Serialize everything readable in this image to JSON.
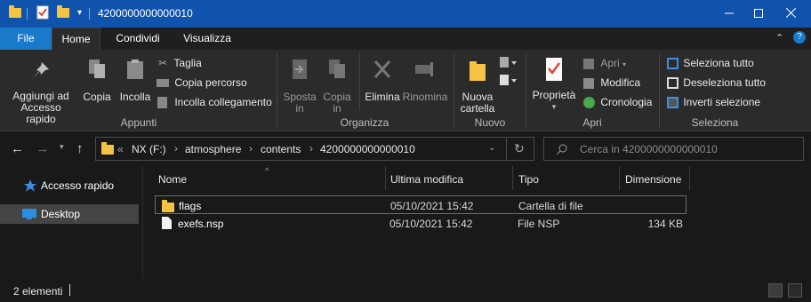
{
  "window": {
    "title": "4200000000000010",
    "minimize_icon": "minimize-icon",
    "maximize_icon": "maximize-icon",
    "close_icon": "close-icon"
  },
  "ribbon_tabs": {
    "file": "File",
    "home": "Home",
    "share": "Condividi",
    "view": "Visualizza"
  },
  "ribbon": {
    "pin": "Aggiungi ad\nAccesso rapido",
    "pin_l1": "Aggiungi ad",
    "pin_l2": "Accesso rapido",
    "copy": "Copia",
    "paste": "Incolla",
    "cut": "Taglia",
    "copy_path": "Copia percorso",
    "paste_shortcut": "Incolla collegamento",
    "group_clipboard": "Appunti",
    "move_to_l1": "Sposta",
    "move_to_l2": "in",
    "copy_to_l1": "Copia",
    "copy_to_l2": "in",
    "delete": "Elimina",
    "rename": "Rinomina",
    "group_organize": "Organizza",
    "new_folder_l1": "Nuova",
    "new_folder_l2": "cartella",
    "group_new": "Nuovo",
    "properties": "Proprietà",
    "open": "Apri",
    "edit": "Modifica",
    "history": "Cronologia",
    "group_open": "Apri",
    "select_all": "Seleziona tutto",
    "select_none": "Deseleziona tutto",
    "invert_selection": "Inverti selezione",
    "group_select": "Seleziona"
  },
  "address": {
    "overflow": "«",
    "crumbs": [
      "NX (F:)",
      "atmosphere",
      "contents",
      "4200000000000010"
    ],
    "search_placeholder": "Cerca in 4200000000000010"
  },
  "nav_pane": {
    "items": [
      {
        "label": "Accesso rapido",
        "icon": "star-icon"
      },
      {
        "label": "Desktop",
        "icon": "desktop-icon"
      }
    ]
  },
  "file_list": {
    "columns": [
      "Nome",
      "Ultima modifica",
      "Tipo",
      "Dimensione"
    ],
    "rows": [
      {
        "name": "flags",
        "modified": "05/10/2021 15:42",
        "type": "Cartella di file",
        "size": "",
        "icon": "folder-icon"
      },
      {
        "name": "exefs.nsp",
        "modified": "05/10/2021 15:42",
        "type": "File NSP",
        "size": "134 KB",
        "icon": "file-icon"
      }
    ]
  },
  "status": {
    "count": "2 elementi"
  },
  "colors": {
    "titlebar": "#0f53ad",
    "file_tab": "#1979ca",
    "background": "#191919",
    "ribbon": "#2b2b2b",
    "folder": "#f6c344"
  }
}
